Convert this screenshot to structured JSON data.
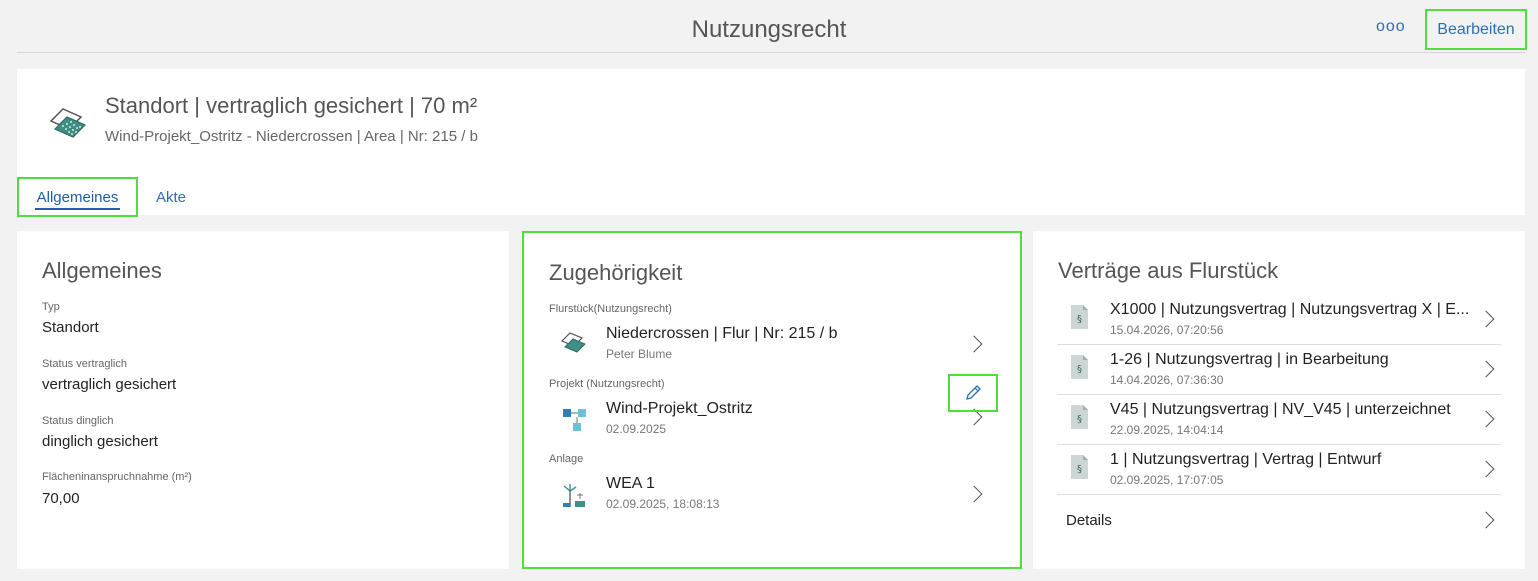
{
  "topbar": {
    "title": "Nutzungsrecht",
    "more_label": "ooo",
    "edit_label": "Bearbeiten"
  },
  "header": {
    "title": "Standort | vertraglich gesichert | 70 m²",
    "subtitle": "Wind-Projekt_Ostritz - Niedercrossen | Area | Nr: 215 / b",
    "icon": "parcel-icon"
  },
  "tabs": [
    {
      "label": "Allgemeines",
      "active": true
    },
    {
      "label": "Akte",
      "active": false
    }
  ],
  "general": {
    "heading": "Allgemeines",
    "fields": [
      {
        "label": "Typ",
        "value": "Standort"
      },
      {
        "label": "Status vertraglich",
        "value": "vertraglich gesichert"
      },
      {
        "label": "Status dinglich",
        "value": "dinglich gesichert"
      },
      {
        "label": "Flächeninanspruchnahme (m²)",
        "value": "70,00"
      }
    ]
  },
  "membership": {
    "heading": "Zugehörigkeit",
    "sections": [
      {
        "label": "Flurstück(Nutzungsrecht)",
        "title": "Niedercrossen | Flur | Nr: 215 / b",
        "subtitle": "Peter Blume",
        "icon": "parcel-icon"
      },
      {
        "label": "Projekt (Nutzungsrecht)",
        "title": "Wind-Projekt_Ostritz",
        "subtitle": "02.09.2025",
        "icon": "project-icon"
      },
      {
        "label": "Anlage",
        "title": "WEA 1",
        "subtitle": "02.09.2025, 18:08:13",
        "icon": "wind-turbine-icon"
      }
    ]
  },
  "contracts": {
    "heading": "Verträge aus Flurstück",
    "items": [
      {
        "title": "X1000 | Nutzungsvertrag | Nutzungsvertrag X | E...",
        "date": "15.04.2026, 07:20:56"
      },
      {
        "title": "1-26 | Nutzungsvertrag | in Bearbeitung",
        "date": "14.04.2026, 07:36:30"
      },
      {
        "title": "V45 | Nutzungsvertrag | NV_V45 | unterzeichnet",
        "date": "22.09.2025, 14:04:14"
      },
      {
        "title": "1 | Nutzungsvertrag | Vertrag | Entwurf",
        "date": "02.09.2025, 17:07:05"
      }
    ],
    "details_label": "Details"
  },
  "colors": {
    "accent": "#2c6fb5",
    "highlight": "#4be13a",
    "card": "#ffffff",
    "background": "#f2f2f2"
  }
}
